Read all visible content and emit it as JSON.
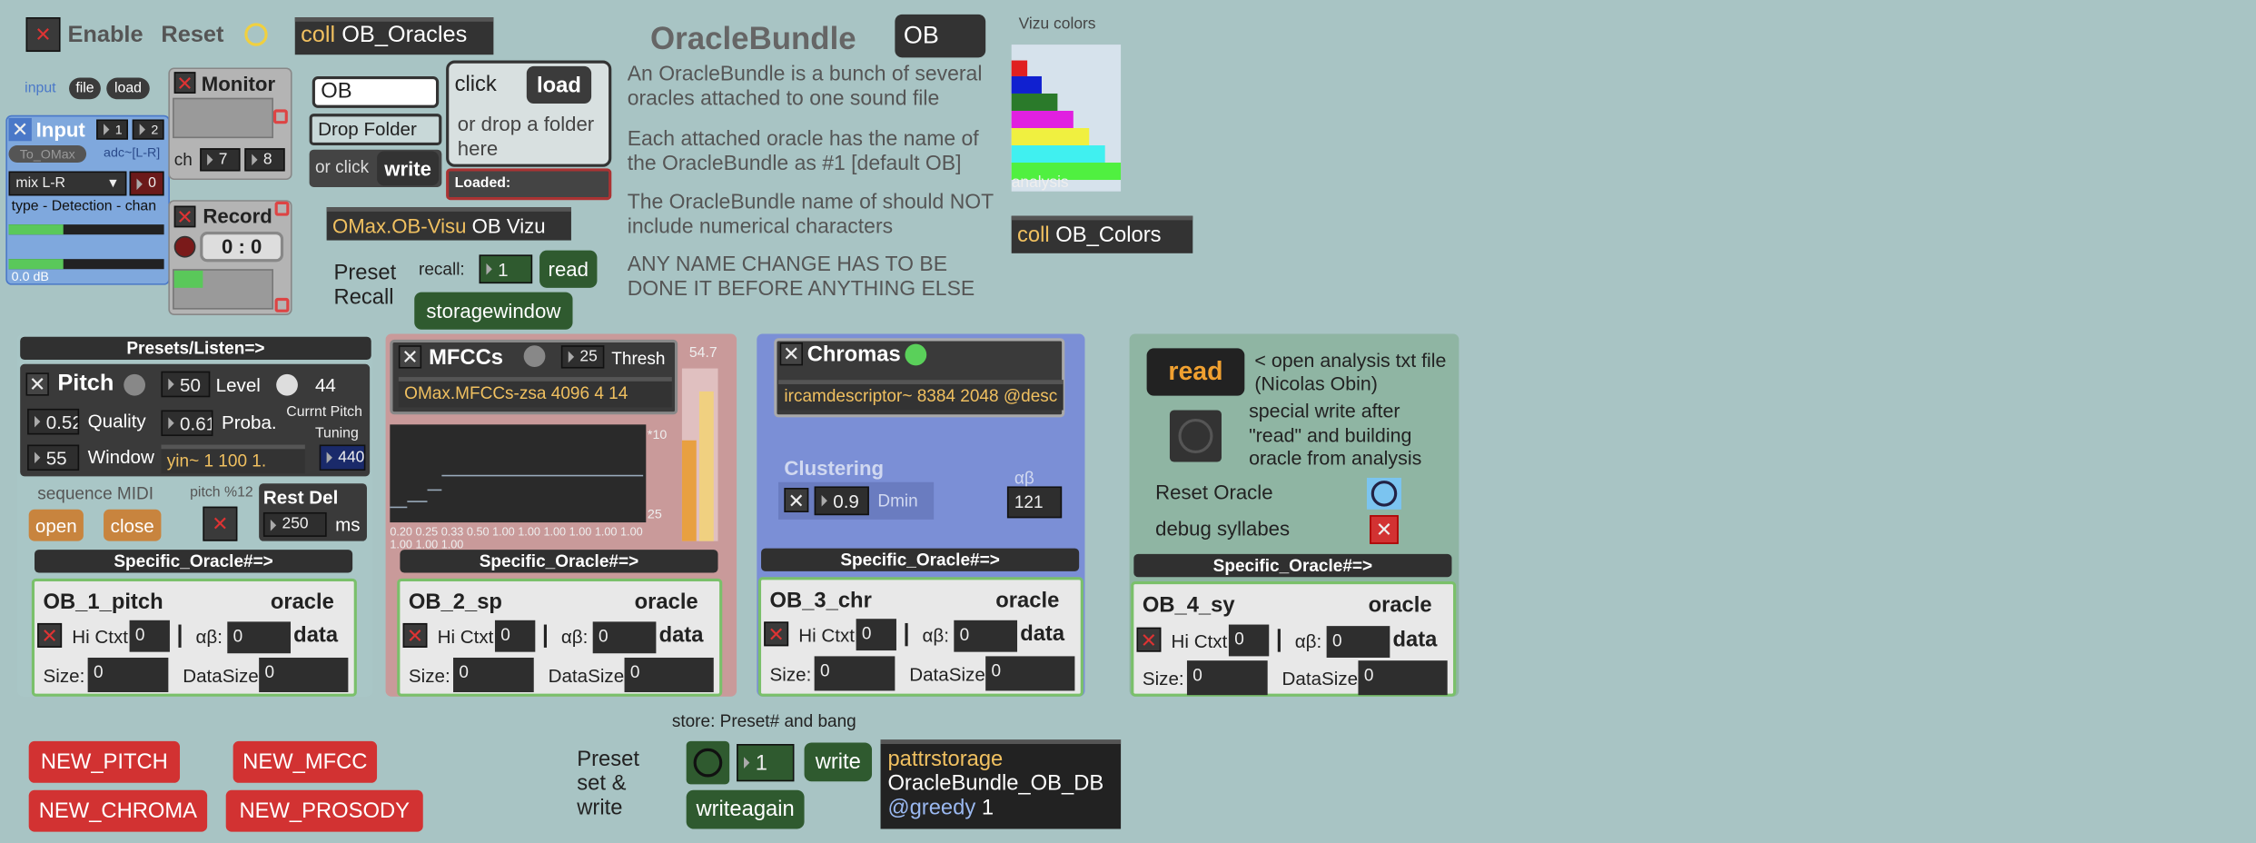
{
  "topbar": {
    "enable": "Enable",
    "reset": "Reset",
    "coll": "coll",
    "coll_name": "OB_Oracles",
    "title": "OracleBundle",
    "name_value": "OB",
    "vizu_colors": "Vizu colors",
    "analysis": "analysis"
  },
  "input": {
    "input_tab": "input",
    "file_tab": "file",
    "load_tab": "load",
    "title": "Input",
    "n1": "1",
    "n2": "2",
    "to_omax": "To_OMax",
    "adc": "adc~[L-R]",
    "mix": "mix L-R",
    "mix_num": "0",
    "type_text": "type - Detection - chan",
    "db": "0.0 dB"
  },
  "monitor": {
    "title": "Monitor",
    "ch": "ch",
    "ch1": "7",
    "ch2": "8"
  },
  "record": {
    "title": "Record",
    "time": "0 : 0"
  },
  "load": {
    "name_field": "OB",
    "drop_folder": "Drop Folder",
    "or_click": "or click",
    "write": "write",
    "click": "click",
    "load": "load",
    "or_drop": "or drop a folder here",
    "loaded": "Loaded:"
  },
  "vizu": {
    "obj": "OMax.OB-Visu",
    "arg": "OB Vizu"
  },
  "desc": {
    "p1": "An OracleBundle is a bunch of several oracles attached to one sound file",
    "p2": "Each attached oracle has the name of the OracleBundle as #1 [default OB]",
    "p3": "The OracleBundle name of should NOT include numerical characters",
    "p4": "ANY NAME CHANGE HAS TO BE DONE IT BEFORE ANYTHING ELSE"
  },
  "colors_coll": {
    "coll": "coll",
    "name": "OB_Colors"
  },
  "preset": {
    "label1": "Preset",
    "label2": "Recall",
    "recall": "recall:",
    "recall_num": "1",
    "read": "read",
    "storagewindow": "storagewindow"
  },
  "pitch": {
    "presets": "Presets/Listen=>",
    "title": "Pitch",
    "n50": "50",
    "level": "Level",
    "level_val": "44",
    "quality_val": "0.52",
    "quality": "Quality",
    "proba_val": "0.61",
    "proba": "Proba.",
    "curr_pitch": "Currnt Pitch",
    "tuning": "Tuning",
    "window_val": "55",
    "window": "Window",
    "yin": "yin~ 1 100 1.",
    "tuning_val": "440",
    "seq_midi": "sequence MIDI",
    "pitch12": "pitch %12",
    "open": "open",
    "close": "close",
    "rest_del": "Rest Del",
    "rest_val": "250",
    "ms": "ms"
  },
  "mfcc": {
    "title": "MFCCs",
    "thresh_val": "25",
    "thresh": "Thresh",
    "val547": "54.7",
    "obj": "OMax.MFCCs-zsa 4096 4 14",
    "ten": "*10",
    "twentyfive": "25",
    "scale": "0.20 0.25 0.33 0.50 1.00 1.00 1.00 1.00 1.00 1.00",
    "scale2": "1.00 1.00 1.00"
  },
  "chroma": {
    "title": "Chromas",
    "obj": "ircamdescriptor~ 8384 2048 @desc",
    "clustering": "Clustering",
    "dmin_val": "0.9",
    "dmin": "Dmin",
    "ab": "αβ",
    "ab_val": "121"
  },
  "syll": {
    "read": "read",
    "read_desc": "< open analysis txt file (Nicolas Obin)",
    "special": "special write after \"read\" and  building oracle from analysis",
    "reset_oracle": "Reset Oracle",
    "debug": "debug syllabes"
  },
  "specific_hdr": "Specific_Oracle#=>",
  "oracles": [
    {
      "name": "OB_1_pitch",
      "oracle": "oracle",
      "hictx": "Hi Ctxt:",
      "hictx_val": "0",
      "ab": "αβ:",
      "ab_val": "0",
      "data": "data",
      "size": "Size:",
      "size_val": "0",
      "datasize": "DataSize",
      "datasize_val": "0"
    },
    {
      "name": "OB_2_sp",
      "oracle": "oracle",
      "hictx": "Hi Ctxt:",
      "hictx_val": "0",
      "ab": "αβ:",
      "ab_val": "0",
      "data": "data",
      "size": "Size:",
      "size_val": "0",
      "datasize": "DataSize",
      "datasize_val": "0"
    },
    {
      "name": "OB_3_chr",
      "oracle": "oracle",
      "hictx": "Hi Ctxt:",
      "hictx_val": "0",
      "ab": "αβ:",
      "ab_val": "0",
      "data": "data",
      "size": "Size:",
      "size_val": "0",
      "datasize": "DataSize",
      "datasize_val": "0"
    },
    {
      "name": "OB_4_sy",
      "oracle": "oracle",
      "hictx": "Hi Ctxt:",
      "hictx_val": "0",
      "ab": "αβ:",
      "ab_val": "0",
      "data": "data",
      "size": "Size:",
      "size_val": "0",
      "datasize": "DataSize",
      "datasize_val": "0"
    }
  ],
  "new_buttons": {
    "pitch": "NEW_PITCH",
    "mfcc": "NEW_MFCC",
    "chroma": "NEW_CHROMA",
    "prosody": "NEW_PROSODY"
  },
  "store": {
    "caption": "store: Preset# and bang",
    "l1": "Preset",
    "l2": "set &",
    "l3": "write",
    "num": "1",
    "write": "write",
    "writeagain": "writeagain",
    "patt1": "pattrstorage",
    "patt2": "OracleBundle_OB_DB",
    "patt3": "@greedy",
    "patt3b": "1"
  },
  "colors": {
    "background": "#a8c4c4",
    "pitch_panel": "#a9c6c6",
    "mfcc_panel": "#c99a9a",
    "chroma_panel": "#7b8fd6",
    "syll_panel": "#8fb5a3",
    "new_button": "#d23232",
    "accent_yellow": "#f0d040"
  }
}
